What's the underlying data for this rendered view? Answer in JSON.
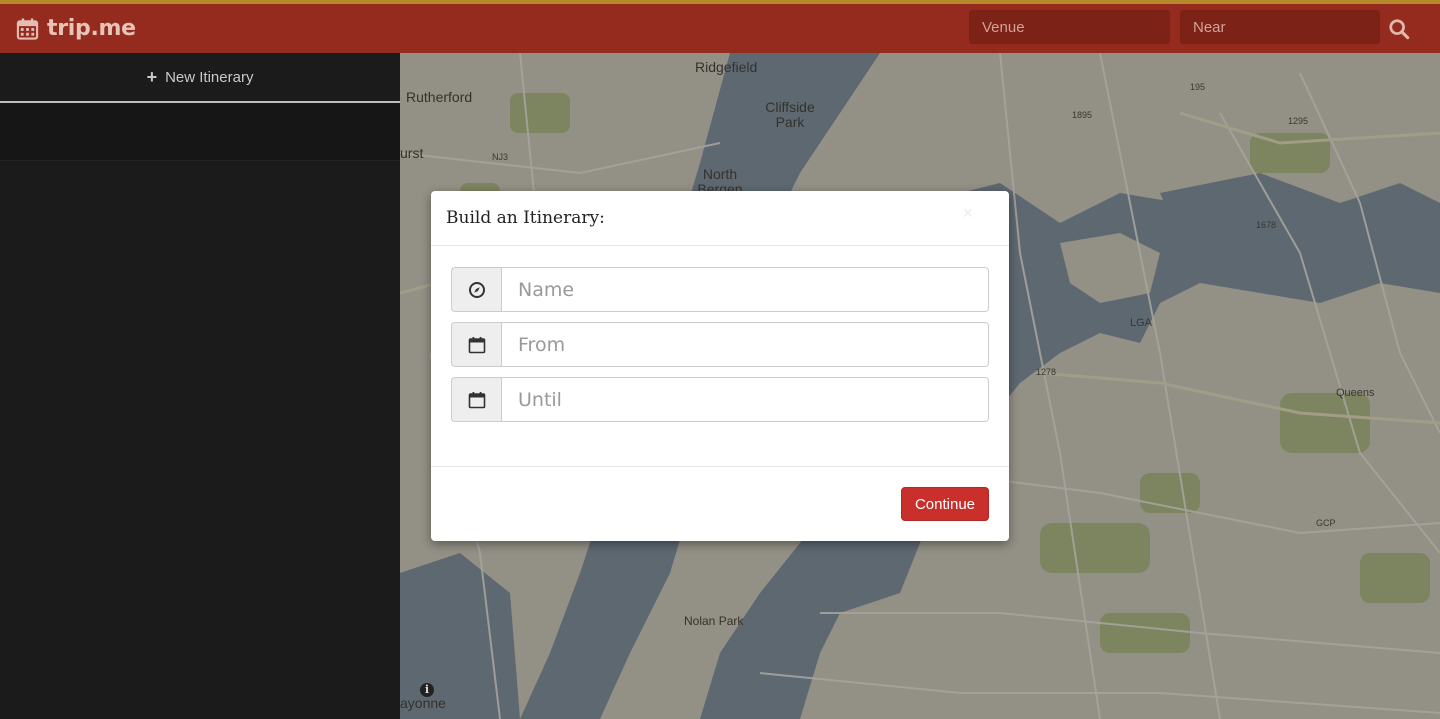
{
  "app": {
    "brand": "trip.me",
    "brand_icon": "calendar-icon",
    "accent": "#952b1e",
    "accent_border": "#b58a2a"
  },
  "navbar": {
    "venue_placeholder": "Venue",
    "near_placeholder": "Near",
    "search_icon": "search-icon"
  },
  "sidebar": {
    "new_itinerary_label": "New Itinerary",
    "new_itinerary_icon": "plus-icon"
  },
  "map": {
    "labels": [
      {
        "text": "Ridgefield"
      },
      {
        "text": "Rutherford"
      },
      {
        "text": "Cliffside Park"
      },
      {
        "text": "urst"
      },
      {
        "text": "North Bergen"
      },
      {
        "text": "LGA"
      },
      {
        "text": "Queens"
      },
      {
        "text": "Nolan Park"
      },
      {
        "text": "ayonne"
      },
      {
        "text": "NJ3"
      },
      {
        "text": "195"
      },
      {
        "text": "1895"
      },
      {
        "text": "1295"
      },
      {
        "text": "1678"
      },
      {
        "text": "1278"
      },
      {
        "text": "GCP"
      }
    ]
  },
  "modal": {
    "title": "Build an Itinerary:",
    "close_label": "×",
    "fields": [
      {
        "icon": "compass-icon",
        "placeholder": "Name",
        "value": ""
      },
      {
        "icon": "calendar-icon",
        "placeholder": "From",
        "value": ""
      },
      {
        "icon": "calendar-icon",
        "placeholder": "Until",
        "value": ""
      }
    ],
    "continue_label": "Continue",
    "continue_color": "#c9302c"
  }
}
